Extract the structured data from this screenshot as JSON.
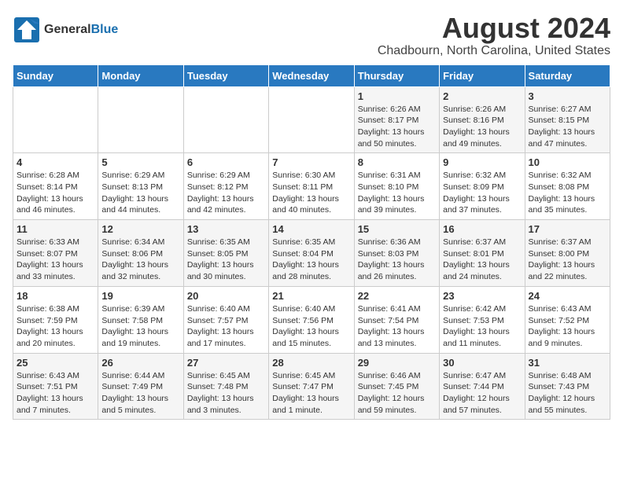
{
  "header": {
    "logo_general": "General",
    "logo_blue": "Blue",
    "main_title": "August 2024",
    "sub_title": "Chadbourn, North Carolina, United States"
  },
  "calendar": {
    "days_of_week": [
      "Sunday",
      "Monday",
      "Tuesday",
      "Wednesday",
      "Thursday",
      "Friday",
      "Saturday"
    ],
    "weeks": [
      [
        {
          "day": "",
          "info": ""
        },
        {
          "day": "",
          "info": ""
        },
        {
          "day": "",
          "info": ""
        },
        {
          "day": "",
          "info": ""
        },
        {
          "day": "1",
          "info": "Sunrise: 6:26 AM\nSunset: 8:17 PM\nDaylight: 13 hours\nand 50 minutes."
        },
        {
          "day": "2",
          "info": "Sunrise: 6:26 AM\nSunset: 8:16 PM\nDaylight: 13 hours\nand 49 minutes."
        },
        {
          "day": "3",
          "info": "Sunrise: 6:27 AM\nSunset: 8:15 PM\nDaylight: 13 hours\nand 47 minutes."
        }
      ],
      [
        {
          "day": "4",
          "info": "Sunrise: 6:28 AM\nSunset: 8:14 PM\nDaylight: 13 hours\nand 46 minutes."
        },
        {
          "day": "5",
          "info": "Sunrise: 6:29 AM\nSunset: 8:13 PM\nDaylight: 13 hours\nand 44 minutes."
        },
        {
          "day": "6",
          "info": "Sunrise: 6:29 AM\nSunset: 8:12 PM\nDaylight: 13 hours\nand 42 minutes."
        },
        {
          "day": "7",
          "info": "Sunrise: 6:30 AM\nSunset: 8:11 PM\nDaylight: 13 hours\nand 40 minutes."
        },
        {
          "day": "8",
          "info": "Sunrise: 6:31 AM\nSunset: 8:10 PM\nDaylight: 13 hours\nand 39 minutes."
        },
        {
          "day": "9",
          "info": "Sunrise: 6:32 AM\nSunset: 8:09 PM\nDaylight: 13 hours\nand 37 minutes."
        },
        {
          "day": "10",
          "info": "Sunrise: 6:32 AM\nSunset: 8:08 PM\nDaylight: 13 hours\nand 35 minutes."
        }
      ],
      [
        {
          "day": "11",
          "info": "Sunrise: 6:33 AM\nSunset: 8:07 PM\nDaylight: 13 hours\nand 33 minutes."
        },
        {
          "day": "12",
          "info": "Sunrise: 6:34 AM\nSunset: 8:06 PM\nDaylight: 13 hours\nand 32 minutes."
        },
        {
          "day": "13",
          "info": "Sunrise: 6:35 AM\nSunset: 8:05 PM\nDaylight: 13 hours\nand 30 minutes."
        },
        {
          "day": "14",
          "info": "Sunrise: 6:35 AM\nSunset: 8:04 PM\nDaylight: 13 hours\nand 28 minutes."
        },
        {
          "day": "15",
          "info": "Sunrise: 6:36 AM\nSunset: 8:03 PM\nDaylight: 13 hours\nand 26 minutes."
        },
        {
          "day": "16",
          "info": "Sunrise: 6:37 AM\nSunset: 8:01 PM\nDaylight: 13 hours\nand 24 minutes."
        },
        {
          "day": "17",
          "info": "Sunrise: 6:37 AM\nSunset: 8:00 PM\nDaylight: 13 hours\nand 22 minutes."
        }
      ],
      [
        {
          "day": "18",
          "info": "Sunrise: 6:38 AM\nSunset: 7:59 PM\nDaylight: 13 hours\nand 20 minutes."
        },
        {
          "day": "19",
          "info": "Sunrise: 6:39 AM\nSunset: 7:58 PM\nDaylight: 13 hours\nand 19 minutes."
        },
        {
          "day": "20",
          "info": "Sunrise: 6:40 AM\nSunset: 7:57 PM\nDaylight: 13 hours\nand 17 minutes."
        },
        {
          "day": "21",
          "info": "Sunrise: 6:40 AM\nSunset: 7:56 PM\nDaylight: 13 hours\nand 15 minutes."
        },
        {
          "day": "22",
          "info": "Sunrise: 6:41 AM\nSunset: 7:54 PM\nDaylight: 13 hours\nand 13 minutes."
        },
        {
          "day": "23",
          "info": "Sunrise: 6:42 AM\nSunset: 7:53 PM\nDaylight: 13 hours\nand 11 minutes."
        },
        {
          "day": "24",
          "info": "Sunrise: 6:43 AM\nSunset: 7:52 PM\nDaylight: 13 hours\nand 9 minutes."
        }
      ],
      [
        {
          "day": "25",
          "info": "Sunrise: 6:43 AM\nSunset: 7:51 PM\nDaylight: 13 hours\nand 7 minutes."
        },
        {
          "day": "26",
          "info": "Sunrise: 6:44 AM\nSunset: 7:49 PM\nDaylight: 13 hours\nand 5 minutes."
        },
        {
          "day": "27",
          "info": "Sunrise: 6:45 AM\nSunset: 7:48 PM\nDaylight: 13 hours\nand 3 minutes."
        },
        {
          "day": "28",
          "info": "Sunrise: 6:45 AM\nSunset: 7:47 PM\nDaylight: 13 hours\nand 1 minute."
        },
        {
          "day": "29",
          "info": "Sunrise: 6:46 AM\nSunset: 7:45 PM\nDaylight: 12 hours\nand 59 minutes."
        },
        {
          "day": "30",
          "info": "Sunrise: 6:47 AM\nSunset: 7:44 PM\nDaylight: 12 hours\nand 57 minutes."
        },
        {
          "day": "31",
          "info": "Sunrise: 6:48 AM\nSunset: 7:43 PM\nDaylight: 12 hours\nand 55 minutes."
        }
      ]
    ]
  }
}
